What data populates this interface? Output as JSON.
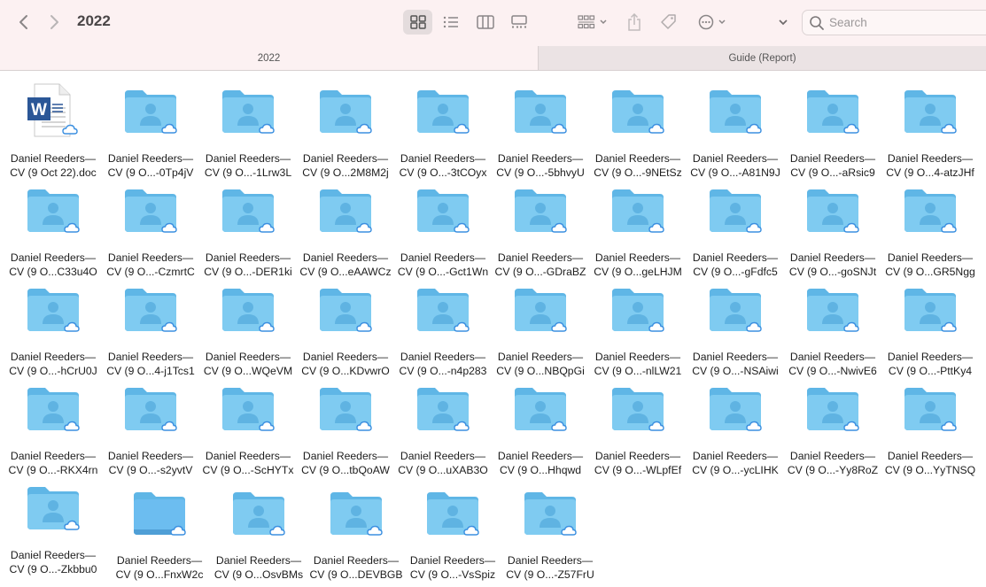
{
  "window": {
    "title": "2022"
  },
  "toolbar": {
    "icons": {
      "back": "chevron-left-icon",
      "forward": "chevron-right-icon",
      "icon_view": "grid-icon",
      "list_view": "list-icon",
      "column_view": "columns-icon",
      "gallery_view": "gallery-icon",
      "group": "group-icon",
      "share": "share-icon",
      "tag": "tag-icon",
      "more": "ellipsis-icon",
      "expand": "chevron-down-icon"
    }
  },
  "search": {
    "placeholder": "Search"
  },
  "tabs": [
    {
      "label": "2022"
    },
    {
      "label": "Guide (Report)"
    }
  ],
  "colors": {
    "folder": "#7fcbf1",
    "folder_dark": "#5fb6e6",
    "toolbar_bg": "#fcf1f2",
    "cloud": "#3b8fe0"
  },
  "files": [
    {
      "line1": "Daniel Reeders—",
      "line2": "CV (9 Oct 22).doc",
      "kind": "doc"
    },
    {
      "line1": "Daniel Reeders—",
      "line2": "CV (9 O...-0Tp4jV",
      "kind": "folder"
    },
    {
      "line1": "Daniel Reeders—",
      "line2": "CV (9 O...-1Lrw3L",
      "kind": "folder"
    },
    {
      "line1": "Daniel Reeders—",
      "line2": "CV (9 O...2M8M2j",
      "kind": "folder"
    },
    {
      "line1": "Daniel Reeders—",
      "line2": "CV (9 O...-3tCOyx",
      "kind": "folder"
    },
    {
      "line1": "Daniel Reeders—",
      "line2": "CV (9 O...-5bhvyU",
      "kind": "folder"
    },
    {
      "line1": "Daniel Reeders—",
      "line2": "CV (9 O...-9NEtSz",
      "kind": "folder"
    },
    {
      "line1": "Daniel Reeders—",
      "line2": "CV (9 O...-A81N9J",
      "kind": "folder"
    },
    {
      "line1": "Daniel Reeders—",
      "line2": "CV (9 O...-aRsic9",
      "kind": "folder"
    },
    {
      "line1": "Daniel Reeders—",
      "line2": "CV (9 O...4-atzJHf",
      "kind": "folder"
    },
    {
      "line1": "Daniel Reeders—",
      "line2": "CV (9 O...C33u4O",
      "kind": "folder"
    },
    {
      "line1": "Daniel Reeders—",
      "line2": "CV (9 O...-CzmrtC",
      "kind": "folder"
    },
    {
      "line1": "Daniel Reeders—",
      "line2": "CV (9 O...-DER1ki",
      "kind": "folder"
    },
    {
      "line1": "Daniel Reeders—",
      "line2": "CV (9 O...eAAWCz",
      "kind": "folder"
    },
    {
      "line1": "Daniel Reeders—",
      "line2": "CV (9 O...-Gct1Wn",
      "kind": "folder"
    },
    {
      "line1": "Daniel Reeders—",
      "line2": "CV (9 O...-GDraBZ",
      "kind": "folder"
    },
    {
      "line1": "Daniel Reeders—",
      "line2": "CV (9 O...geLHJM",
      "kind": "folder"
    },
    {
      "line1": "Daniel Reeders—",
      "line2": "CV (9 O...-gFdfc5",
      "kind": "folder"
    },
    {
      "line1": "Daniel Reeders—",
      "line2": "CV (9 O...-goSNJt",
      "kind": "folder"
    },
    {
      "line1": "Daniel Reeders—",
      "line2": "CV (9 O...GR5Ngg",
      "kind": "folder"
    },
    {
      "line1": "Daniel Reeders—",
      "line2": "CV (9 O...-hCrU0J",
      "kind": "folder"
    },
    {
      "line1": "Daniel Reeders—",
      "line2": "CV (9 O...4-j1Tcs1",
      "kind": "folder"
    },
    {
      "line1": "Daniel Reeders—",
      "line2": "CV (9 O...WQeVM",
      "kind": "folder"
    },
    {
      "line1": "Daniel Reeders—",
      "line2": "CV (9 O...KDvwrO",
      "kind": "folder"
    },
    {
      "line1": "Daniel Reeders—",
      "line2": "CV (9 O...-n4p283",
      "kind": "folder"
    },
    {
      "line1": "Daniel Reeders—",
      "line2": "CV (9 O...NBQpGi",
      "kind": "folder"
    },
    {
      "line1": "Daniel Reeders—",
      "line2": "CV (9 O...-nlLW21",
      "kind": "folder"
    },
    {
      "line1": "Daniel Reeders—",
      "line2": "CV (9 O...-NSAiwi",
      "kind": "folder"
    },
    {
      "line1": "Daniel Reeders—",
      "line2": "CV (9 O...-NwivE6",
      "kind": "folder"
    },
    {
      "line1": "Daniel Reeders—",
      "line2": "CV (9 O...-PttKy4",
      "kind": "folder"
    },
    {
      "line1": "Daniel Reeders—",
      "line2": "CV (9 O...-RKX4rn",
      "kind": "folder"
    },
    {
      "line1": "Daniel Reeders—",
      "line2": "CV (9 O...-s2yvtV",
      "kind": "folder"
    },
    {
      "line1": "Daniel Reeders—",
      "line2": "CV (9 O...-ScHYTx",
      "kind": "folder"
    },
    {
      "line1": "Daniel Reeders—",
      "line2": "CV (9 O...tbQoAW",
      "kind": "folder"
    },
    {
      "line1": "Daniel Reeders—",
      "line2": "CV (9 O...uXAB3O",
      "kind": "folder"
    },
    {
      "line1": "Daniel Reeders—",
      "line2": "CV (9 O...Hhqwd",
      "kind": "folder"
    },
    {
      "line1": "Daniel Reeders—",
      "line2": "CV (9 O...-WLpfEf",
      "kind": "folder"
    },
    {
      "line1": "Daniel Reeders—",
      "line2": "CV (9 O...-ycLIHK",
      "kind": "folder"
    },
    {
      "line1": "Daniel Reeders—",
      "line2": "CV (9 O...-Yy8RoZ",
      "kind": "folder"
    },
    {
      "line1": "Daniel Reeders—",
      "line2": "CV (9 O...YyTNSQ",
      "kind": "folder"
    },
    {
      "line1": "Daniel Reeders—",
      "line2": "CV (9 O...-Zkbbu0",
      "kind": "folder"
    },
    {
      "line1": "Daniel Reeders—",
      "line2": "CV (9 O...FnxW2c",
      "kind": "folder-plain"
    },
    {
      "line1": "Daniel Reeders—",
      "line2": "CV (9 O...OsvBMs",
      "kind": "folder"
    },
    {
      "line1": "Daniel Reeders—",
      "line2": "CV (9 O...DEVBGB",
      "kind": "folder"
    },
    {
      "line1": "Daniel Reeders—",
      "line2": "CV (9 O...-VsSpiz",
      "kind": "folder"
    },
    {
      "line1": "Daniel Reeders—",
      "line2": "CV (9 O...-Z57FrU",
      "kind": "folder"
    }
  ]
}
